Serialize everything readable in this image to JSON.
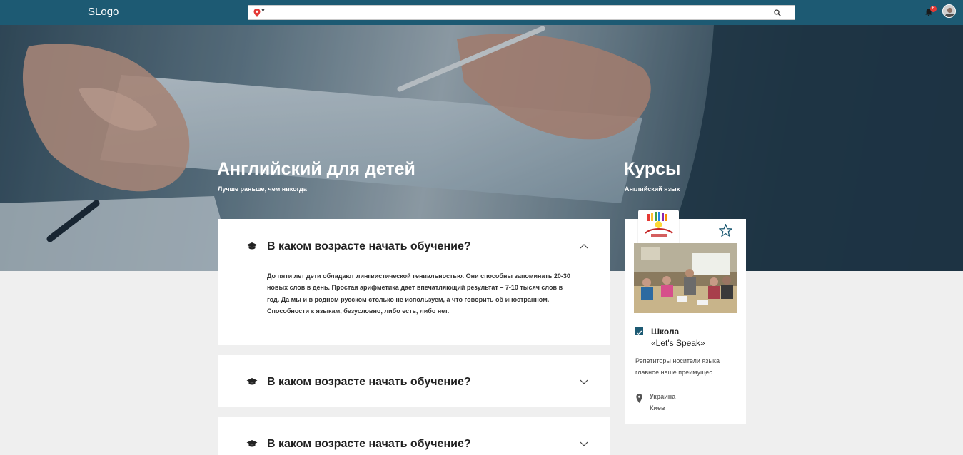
{
  "header": {
    "logo": "SLogo",
    "search_value": "",
    "notification_count": "6"
  },
  "hero": {
    "title": "Английский для детей",
    "subtitle": "Лучше раньше, чем никогда",
    "side_title": "Курсы",
    "side_subtitle": "Английский язык"
  },
  "faq": [
    {
      "question": "В каком возрасте начать обучение?",
      "answer": "До пяти лет дети обладают лингвистической гениальностью. Они способны запоминать 20-30 новых слов в день. Простая арифметика дает впечатляющий результат – 7-10 тысяч слов в год. Да мы и в родном русском столько не используем, а что говорить об иностранном. Способности к языкам, безусловно, либо есть, либо нет.",
      "expanded": true
    },
    {
      "question": "В каком возрасте начать обучение?",
      "expanded": false
    },
    {
      "question": "В каком возрасте начать обучение?",
      "expanded": false
    }
  ],
  "school_card": {
    "name_line1": "Школа",
    "name_line2": "«Let's Speak»",
    "description": "Репетиторы носители языка главное наше преимущес...",
    "country": "Украина",
    "city": "Киев"
  },
  "icons": {
    "location": "map-pin-icon",
    "search": "search-icon",
    "notifications": "bell-icon",
    "faq": "graduation-cap-icon",
    "favorite": "star-outline-icon"
  },
  "colors": {
    "topbar": "#1d5a73",
    "accent": "#1d5a73",
    "badge": "#e53935",
    "page_bg": "#efefef"
  }
}
